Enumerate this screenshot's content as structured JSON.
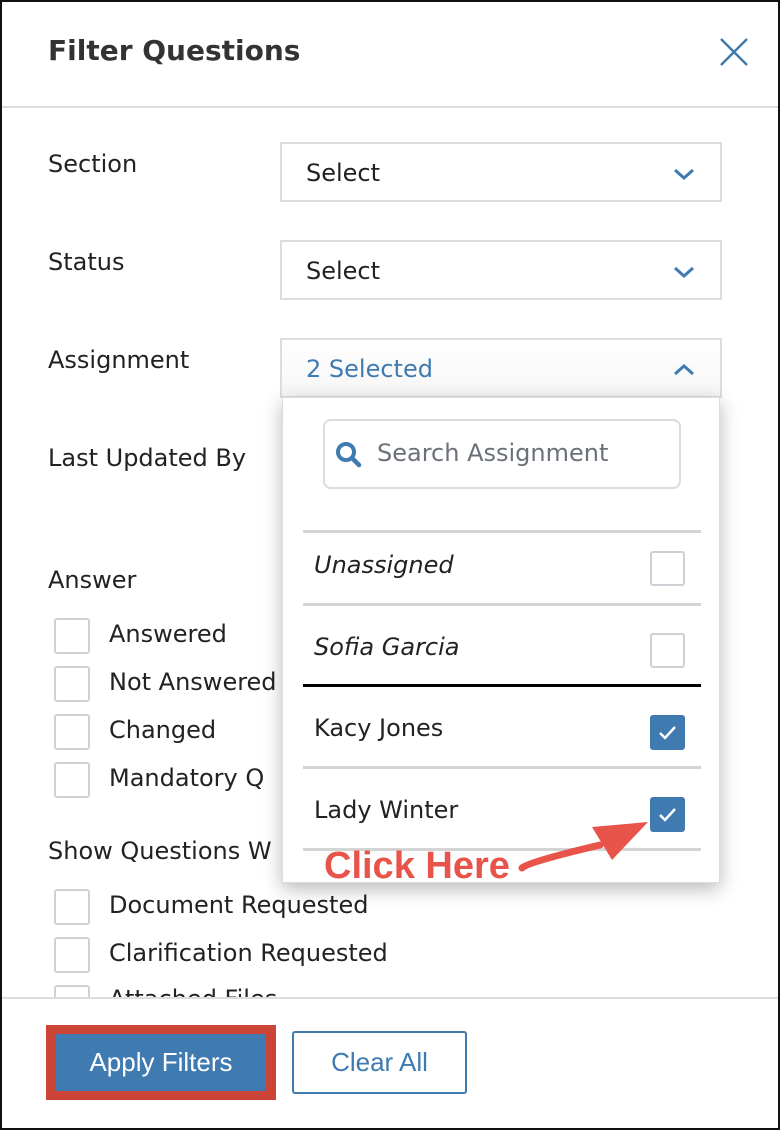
{
  "dialog": {
    "title": "Filter Questions",
    "close_icon": "close-icon"
  },
  "filters": {
    "section": {
      "label": "Section",
      "value": "Select"
    },
    "status": {
      "label": "Status",
      "value": "Select"
    },
    "assignment": {
      "label": "Assignment",
      "value": "2 Selected",
      "expanded": true
    },
    "last_updated_by": {
      "label": "Last Updated By"
    }
  },
  "assignment_dropdown": {
    "search_placeholder": "Search Assignment",
    "options": [
      {
        "label": "Unassigned",
        "checked": false,
        "italic": true
      },
      {
        "label": "Sofia Garcia",
        "checked": false,
        "italic": true
      },
      {
        "label": "Kacy Jones",
        "checked": true,
        "italic": false
      },
      {
        "label": "Lady Winter",
        "checked": true,
        "italic": false
      }
    ]
  },
  "answer": {
    "label": "Answer",
    "options": [
      {
        "label": "Answered",
        "checked": false
      },
      {
        "label": "Not Answered",
        "checked": false
      },
      {
        "label": "Changed",
        "checked": false
      },
      {
        "label": "Mandatory Q",
        "checked": false
      }
    ]
  },
  "show_questions": {
    "label": "Show Questions W",
    "options": [
      {
        "label": "Document Requested",
        "checked": false
      },
      {
        "label": "Clarification Requested",
        "checked": false
      },
      {
        "label": "Attached Files",
        "checked": false
      }
    ]
  },
  "footer": {
    "apply_label": "Apply Filters",
    "clear_label": "Clear All"
  },
  "annotation": {
    "text": "Click Here",
    "color": "#e8534a"
  },
  "colors": {
    "accent": "#3f7ab0",
    "highlight": "#cc4438"
  }
}
